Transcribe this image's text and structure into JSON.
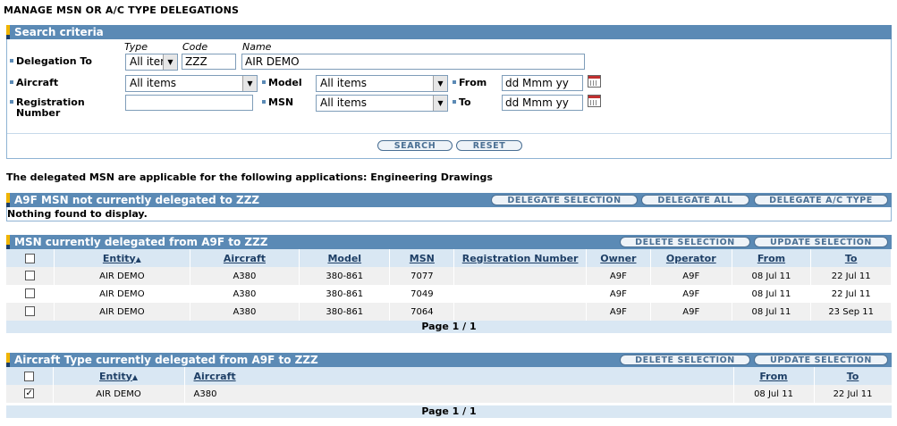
{
  "page_title": "MANAGE MSN OR A/C TYPE DELEGATIONS",
  "search": {
    "header": "Search criteria",
    "col_type": "Type",
    "col_code": "Code",
    "col_name": "Name",
    "delegation_to_label": "Delegation To",
    "type_value": "All iter",
    "code_value": "ZZZ",
    "name_value": "AIR DEMO",
    "aircraft_label": "Aircraft",
    "aircraft_value": "All items",
    "model_label": "Model",
    "model_value": "All items",
    "from_label": "From",
    "from_placeholder": "dd Mmm yy",
    "registration_label_1": "Registration",
    "registration_label_2": "Number",
    "registration_value": "",
    "msn_label": "MSN",
    "msn_value": "All items",
    "to_label": "To",
    "to_placeholder": "dd Mmm yy",
    "search_button": "SEARCH",
    "reset_button": "RESET"
  },
  "info_text": "The delegated MSN are applicable for the following applications: Engineering Drawings",
  "not_delegated": {
    "header": "A9F MSN not currently delegated to ZZZ",
    "btn_delegate_selection": "DELEGATE SELECTION",
    "btn_delegate_all": "DELEGATE ALL",
    "btn_delegate_type": "DELEGATE A/C TYPE",
    "empty_text": "Nothing found to display."
  },
  "msn_delegated": {
    "header": "MSN currently delegated from A9F to ZZZ",
    "btn_delete": "DELETE SELECTION",
    "btn_update": "UPDATE SELECTION",
    "columns": [
      "Entity",
      "Aircraft",
      "Model",
      "MSN",
      "Registration Number",
      "Owner",
      "Operator",
      "From",
      "To"
    ],
    "rows": [
      {
        "entity": "AIR DEMO",
        "aircraft": "A380",
        "model": "380-861",
        "msn": "7077",
        "registration": "",
        "owner": "A9F",
        "operator": "A9F",
        "from": "08 Jul 11",
        "to": "22 Jul 11",
        "checked": false
      },
      {
        "entity": "AIR DEMO",
        "aircraft": "A380",
        "model": "380-861",
        "msn": "7049",
        "registration": "",
        "owner": "A9F",
        "operator": "A9F",
        "from": "08 Jul 11",
        "to": "22 Jul 11",
        "checked": false
      },
      {
        "entity": "AIR DEMO",
        "aircraft": "A380",
        "model": "380-861",
        "msn": "7064",
        "registration": "",
        "owner": "A9F",
        "operator": "A9F",
        "from": "08 Jul 11",
        "to": "23 Sep 11",
        "checked": false
      }
    ],
    "pager": "Page 1 / 1"
  },
  "type_delegated": {
    "header": "Aircraft Type currently delegated from A9F to ZZZ",
    "btn_delete": "DELETE SELECTION",
    "btn_update": "UPDATE SELECTION",
    "columns": [
      "Entity",
      "Aircraft",
      "From",
      "To"
    ],
    "rows": [
      {
        "entity": "AIR DEMO",
        "aircraft": "A380",
        "from": "08 Jul 11",
        "to": "22 Jul 11",
        "checked": true
      }
    ],
    "pager": "Page 1 / 1"
  },
  "icons": {
    "sort": "sort-ascending-icon",
    "calendar": "calendar-icon",
    "dropdown": "chevron-down-icon",
    "checkbox": "checkbox-icon"
  },
  "colors": {
    "header_bar": "#5b8ab5",
    "accent": "#f0b400",
    "grid_header": "#d9e7f3"
  }
}
